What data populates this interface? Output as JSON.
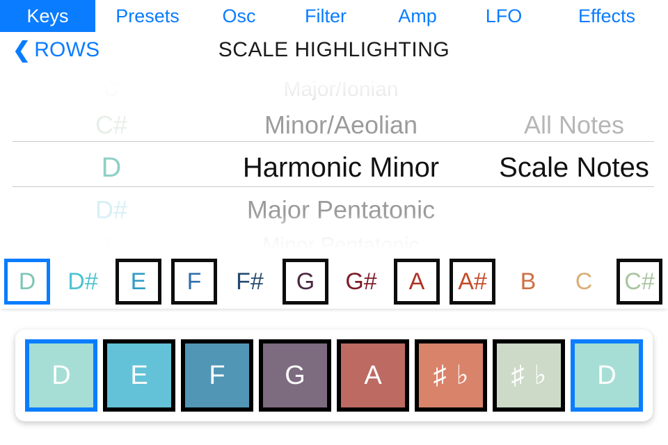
{
  "tabs": [
    {
      "label": "Keys",
      "selected": true
    },
    {
      "label": "Presets",
      "selected": false
    },
    {
      "label": "Osc",
      "selected": false
    },
    {
      "label": "Filter",
      "selected": false
    },
    {
      "label": "Amp",
      "selected": false
    },
    {
      "label": "LFO",
      "selected": false
    },
    {
      "label": "Effects",
      "selected": false
    }
  ],
  "nav": {
    "back_label": "ROWS",
    "back_chevron": "chevron-left-icon",
    "title": "SCALE HIGHLIGHTING"
  },
  "picker": {
    "note_column": {
      "rows": [
        "C",
        "C#",
        "D",
        "D#",
        "E"
      ],
      "selected": "D",
      "selected_index": 2,
      "colors": [
        "#e8dfd2",
        "#d9e6da",
        "#8fd0c6",
        "#bfe6ef",
        "#cfe7f2"
      ]
    },
    "scale_column": {
      "rows": [
        "Major/Ionian",
        "Minor/Aeolian",
        "Harmonic Minor",
        "Major Pentatonic",
        "Minor Pentatonic"
      ],
      "selected": "Harmonic Minor",
      "selected_index": 2
    },
    "mode_column": {
      "rows": [
        "",
        "All Notes",
        "Scale Notes",
        "",
        ""
      ],
      "selected": "Scale Notes",
      "selected_index": 2
    }
  },
  "note_strip": {
    "notes": [
      {
        "label": "D",
        "color": "#7fc6b8",
        "state": "root"
      },
      {
        "label": "D#",
        "color": "#4cc3d0",
        "state": "plain"
      },
      {
        "label": "E",
        "color": "#2f9cc4",
        "state": "boxed"
      },
      {
        "label": "F",
        "color": "#2f6fa8",
        "state": "boxed"
      },
      {
        "label": "F#",
        "color": "#24496f",
        "state": "plain"
      },
      {
        "label": "G",
        "color": "#4a2742",
        "state": "boxed"
      },
      {
        "label": "G#",
        "color": "#7d1b28",
        "state": "plain"
      },
      {
        "label": "A",
        "color": "#b03225",
        "state": "boxed"
      },
      {
        "label": "A#",
        "color": "#c44a26",
        "state": "boxed"
      },
      {
        "label": "B",
        "color": "#cf7046",
        "state": "plain"
      },
      {
        "label": "C",
        "color": "#d9ae78",
        "state": "plain"
      },
      {
        "label": "C#",
        "color": "#a8c4a0",
        "state": "boxed"
      }
    ]
  },
  "keyboard": {
    "keys": [
      {
        "label": "D",
        "type": "note",
        "fill": "#a6ded6",
        "border": "root"
      },
      {
        "label": "E",
        "type": "note",
        "fill": "#63c2d8",
        "border": "black"
      },
      {
        "label": "F",
        "type": "note",
        "fill": "#5296b5",
        "border": "black"
      },
      {
        "label": "G",
        "type": "note",
        "fill": "#7d6b80",
        "border": "black"
      },
      {
        "label": "A",
        "type": "note",
        "fill": "#bc6a62",
        "border": "black"
      },
      {
        "label": "♯ ♭",
        "type": "accidental",
        "fill": "#d9836a",
        "border": "black",
        "sharp": "♯",
        "flat": "♭"
      },
      {
        "label": "♯ ♭",
        "type": "accidental",
        "fill": "#ccdac7",
        "border": "black",
        "sharp": "♯",
        "flat": "♭"
      },
      {
        "label": "D",
        "type": "note",
        "fill": "#a6ded6",
        "border": "root"
      }
    ]
  },
  "theme": {
    "accent_blue": "#0a7cff",
    "key_border_black": "#000000",
    "separator": "#c9c9c9"
  }
}
